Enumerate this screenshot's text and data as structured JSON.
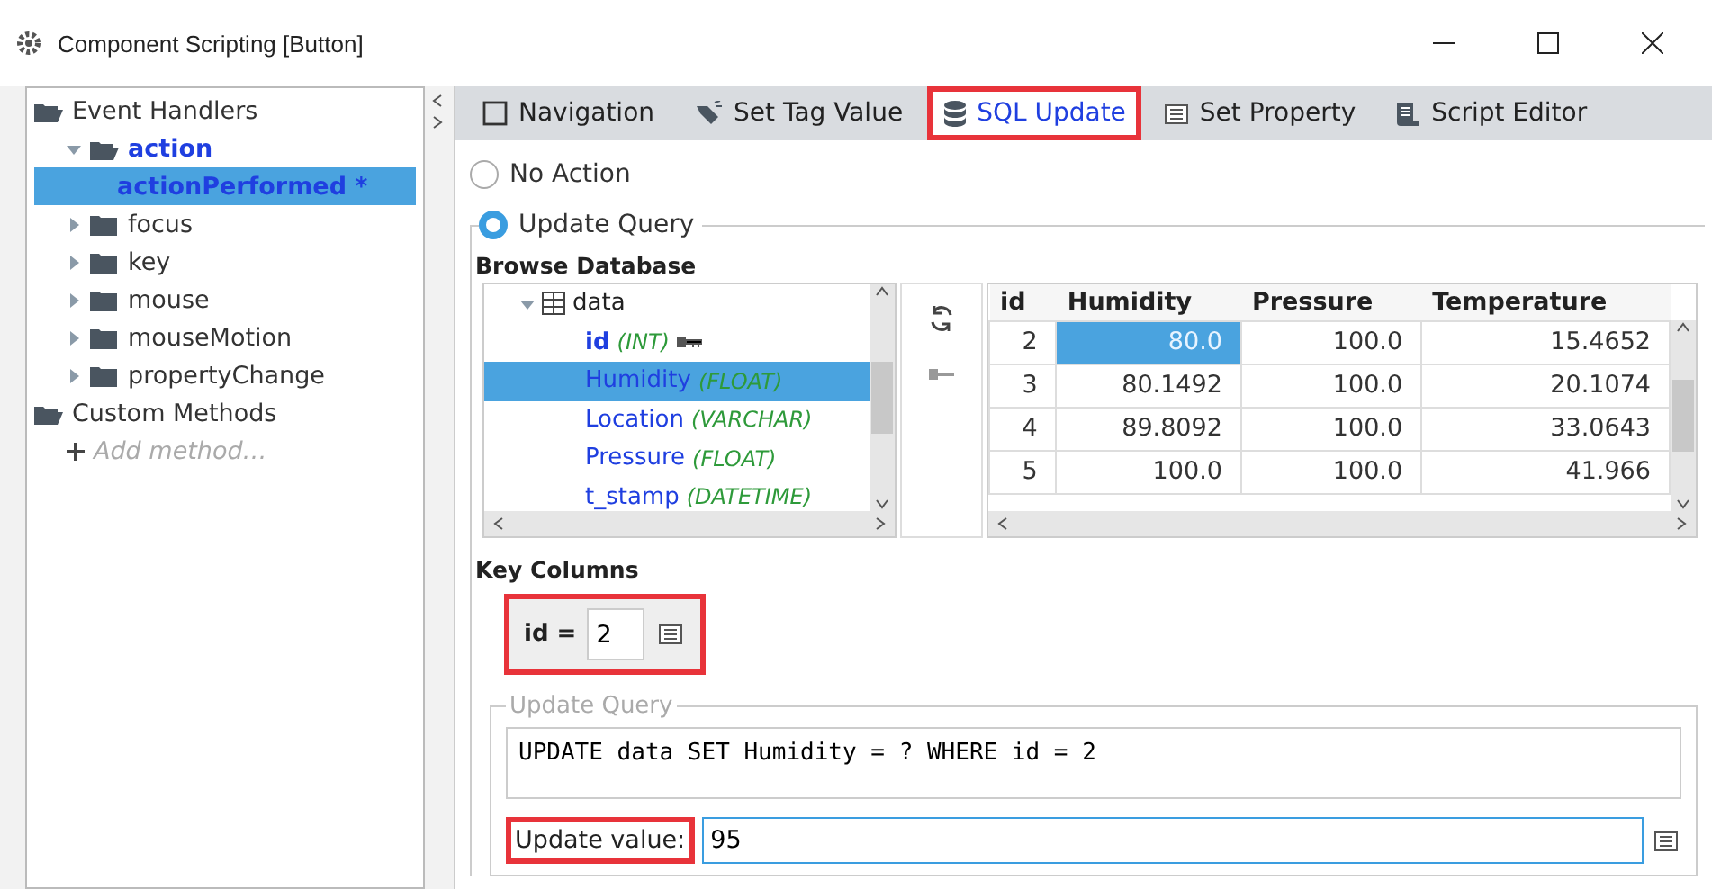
{
  "window": {
    "title": "Component Scripting [Button]"
  },
  "tree": [
    {
      "label": "Event Handlers",
      "kind": "root",
      "expanded": true,
      "children": [
        {
          "label": "action",
          "kind": "folder",
          "expanded": true,
          "active": true,
          "children": [
            {
              "label": "actionPerformed *",
              "kind": "leaf",
              "selected": true
            }
          ]
        },
        {
          "label": "focus",
          "kind": "folder",
          "expanded": false,
          "active": false
        },
        {
          "label": "key",
          "kind": "folder",
          "expanded": false,
          "active": false
        },
        {
          "label": "mouse",
          "kind": "folder",
          "expanded": false,
          "active": false
        },
        {
          "label": "mouseMotion",
          "kind": "folder",
          "expanded": false,
          "active": false
        },
        {
          "label": "propertyChange",
          "kind": "folder",
          "expanded": false,
          "active": false
        }
      ]
    },
    {
      "label": "Custom Methods",
      "kind": "root",
      "expanded": true,
      "children": [
        {
          "label": "Add method…",
          "kind": "add"
        }
      ]
    }
  ],
  "tabs": [
    {
      "label": "Navigation",
      "selected": false,
      "highlighted": false
    },
    {
      "label": "Set Tag Value",
      "selected": false,
      "highlighted": false
    },
    {
      "label": "SQL Update",
      "selected": true,
      "highlighted": true
    },
    {
      "label": "Set Property",
      "selected": false,
      "highlighted": false
    },
    {
      "label": "Script Editor",
      "selected": false,
      "highlighted": false
    }
  ],
  "options": [
    {
      "label": "No Action",
      "selected": false
    },
    {
      "label": "Update Query",
      "selected": true
    }
  ],
  "browse": {
    "title": "Browse Database",
    "table_name": "data",
    "columns": [
      {
        "name": "id",
        "type": "(INT)",
        "key": true,
        "selected": false
      },
      {
        "name": "Humidity",
        "type": "(FLOAT)",
        "key": false,
        "selected": true
      },
      {
        "name": "Location",
        "type": "(VARCHAR)",
        "key": false,
        "selected": false
      },
      {
        "name": "Pressure",
        "type": "(FLOAT)",
        "key": false,
        "selected": false
      },
      {
        "name": "t_stamp",
        "type": "(DATETIME)",
        "key": false,
        "selected": false
      }
    ]
  },
  "table": {
    "columns": [
      "id",
      "Humidity",
      "Pressure",
      "Temperature"
    ],
    "rows": [
      {
        "cells": [
          {
            "text": "2",
            "selected": false
          },
          {
            "text": "80.0",
            "selected": true
          },
          {
            "text": "100.0",
            "selected": false
          },
          {
            "text": "15.4652",
            "selected": false
          }
        ]
      },
      {
        "cells": [
          {
            "text": "3",
            "selected": false
          },
          {
            "text": "80.1492",
            "selected": false
          },
          {
            "text": "100.0",
            "selected": false
          },
          {
            "text": "20.1074",
            "selected": false
          }
        ]
      },
      {
        "cells": [
          {
            "text": "4",
            "selected": false
          },
          {
            "text": "89.8092",
            "selected": false
          },
          {
            "text": "100.0",
            "selected": false
          },
          {
            "text": "33.0643",
            "selected": false
          }
        ]
      },
      {
        "cells": [
          {
            "text": "5",
            "selected": false
          },
          {
            "text": "100.0",
            "selected": false
          },
          {
            "text": "100.0",
            "selected": false
          },
          {
            "text": "41.966",
            "selected": false
          }
        ]
      }
    ]
  },
  "key_columns": {
    "title": "Key Columns",
    "highlighted": true,
    "items": [
      {
        "label": "id =",
        "value": "2"
      }
    ]
  },
  "update_query": {
    "title": "Update Query",
    "query": "UPDATE data SET Humidity = ? WHERE id = 2",
    "value_label": "Update value:",
    "value": "95",
    "highlighted": true
  }
}
